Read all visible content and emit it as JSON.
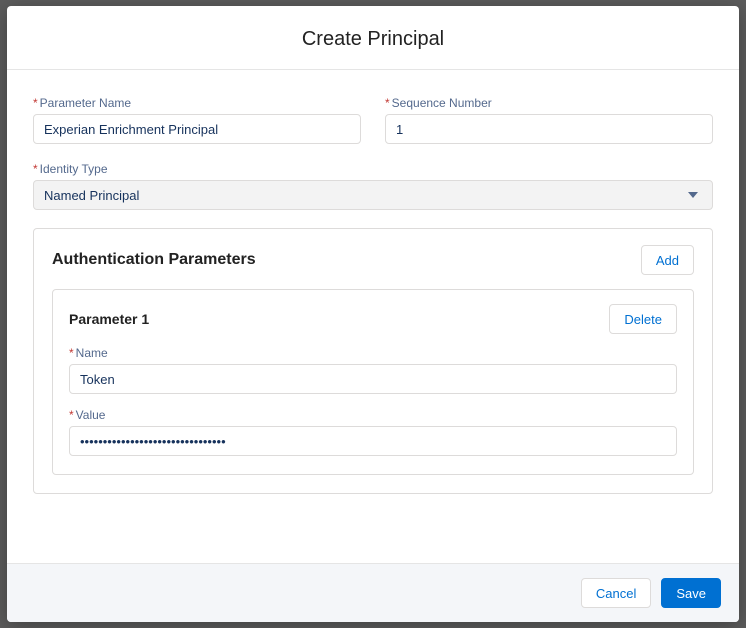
{
  "modal": {
    "title": "Create Principal"
  },
  "fields": {
    "parameterName": {
      "label": "Parameter Name",
      "value": "Experian Enrichment Principal"
    },
    "sequenceNumber": {
      "label": "Sequence Number",
      "value": "1"
    },
    "identityType": {
      "label": "Identity Type",
      "value": "Named Principal"
    }
  },
  "authPanel": {
    "title": "Authentication Parameters",
    "addLabel": "Add",
    "params": [
      {
        "title": "Parameter 1",
        "deleteLabel": "Delete",
        "name": {
          "label": "Name",
          "value": "Token"
        },
        "value": {
          "label": "Value",
          "value": "••••••••••••••••••••••••••••••••"
        }
      }
    ]
  },
  "footer": {
    "cancel": "Cancel",
    "save": "Save"
  }
}
